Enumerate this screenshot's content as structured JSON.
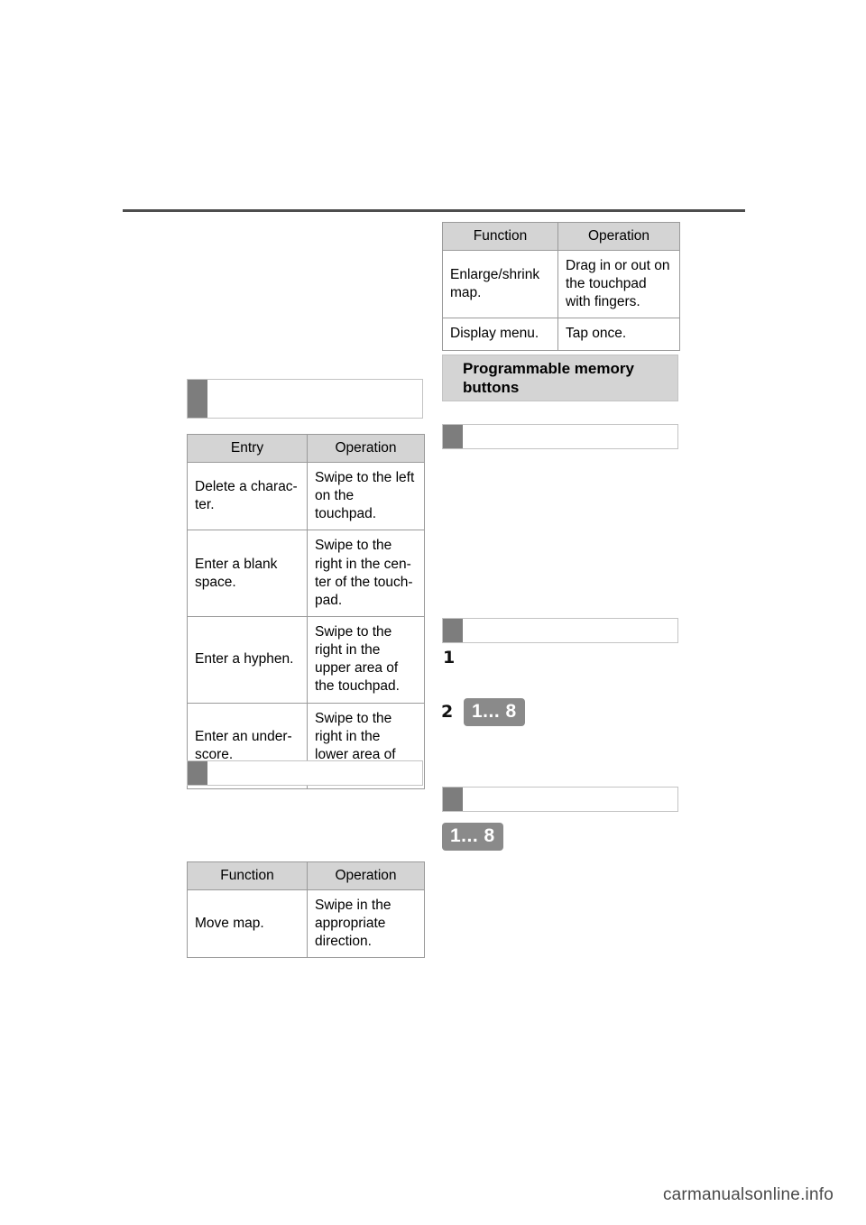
{
  "document": {
    "footer_text": "carmanualsonline.info"
  },
  "left_column": {
    "section_header_1": "",
    "entry_table": {
      "headers": [
        "Entry",
        "Operation"
      ],
      "rows": [
        [
          "Delete a charac-\nter.",
          "Swipe to the left on the touchpad."
        ],
        [
          "Enter a blank space.",
          "Swipe to the right in the cen-ter of the touch-pad."
        ],
        [
          "Enter a hyphen.",
          "Swipe to the right in the upper area of the touchpad."
        ],
        [
          "Enter an under-score.",
          "Swipe to the right in the lower area of the touchpad."
        ]
      ]
    },
    "section_header_2": "",
    "function_table": {
      "headers": [
        "Function",
        "Operation"
      ],
      "rows": [
        [
          "Move map.",
          "Swipe in the appropriate direction."
        ]
      ]
    }
  },
  "right_column": {
    "function_table": {
      "headers": [
        "Function",
        "Operation"
      ],
      "rows": [
        [
          "Enlarge/shrink map.",
          "Drag in or out on the touchpad with fingers."
        ],
        [
          "Display menu.",
          "Tap once."
        ]
      ]
    },
    "main_heading": "Programmable memory buttons",
    "section_header_1": "",
    "section_header_2": "",
    "section_header_3": "",
    "step_1_number": "1",
    "step_2_number": "2",
    "chip_step2_label": "1... 8",
    "chip_bottom_label": "1... 8"
  }
}
